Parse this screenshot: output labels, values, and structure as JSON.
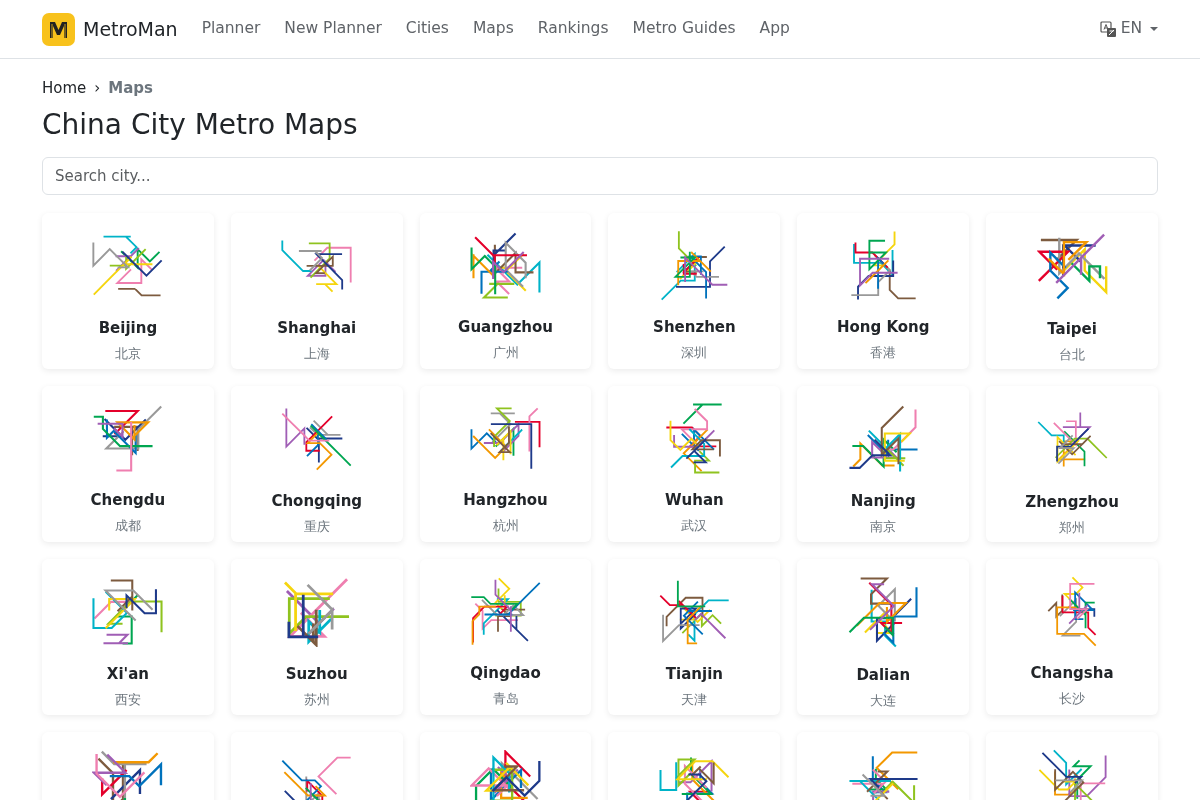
{
  "brand": "MetroMan",
  "nav": [
    {
      "label": "Planner"
    },
    {
      "label": "New Planner"
    },
    {
      "label": "Cities"
    },
    {
      "label": "Maps"
    },
    {
      "label": "Rankings"
    },
    {
      "label": "Metro Guides"
    },
    {
      "label": "App"
    }
  ],
  "language": "EN",
  "breadcrumb": [
    {
      "label": "Home",
      "current": false
    },
    {
      "label": "Maps",
      "current": true
    }
  ],
  "breadcrumb_separator": "›",
  "title": "China City Metro Maps",
  "search": {
    "placeholder": "Search city..."
  },
  "cities": [
    {
      "kind": "city",
      "name": "Beijing",
      "name_zh": "北京"
    },
    {
      "kind": "city",
      "name": "Shanghai",
      "name_zh": "上海"
    },
    {
      "kind": "city",
      "name": "Guangzhou",
      "name_zh": "广州"
    },
    {
      "kind": "city",
      "name": "Shenzhen",
      "name_zh": "深圳"
    },
    {
      "kind": "city",
      "name": "Hong Kong",
      "name_zh": "香港"
    },
    {
      "kind": "city",
      "name": "Taipei",
      "name_zh": "台北"
    },
    {
      "kind": "city",
      "name": "Chengdu",
      "name_zh": "成都"
    },
    {
      "kind": "city",
      "name": "Chongqing",
      "name_zh": "重庆"
    },
    {
      "kind": "city",
      "name": "Hangzhou",
      "name_zh": "杭州"
    },
    {
      "kind": "city",
      "name": "Wuhan",
      "name_zh": "武汉"
    },
    {
      "kind": "city",
      "name": "Nanjing",
      "name_zh": "南京"
    },
    {
      "kind": "city",
      "name": "Zhengzhou",
      "name_zh": "郑州"
    },
    {
      "kind": "city",
      "name": "Xi'an",
      "name_zh": "西安"
    },
    {
      "kind": "city",
      "name": "Suzhou",
      "name_zh": "苏州"
    },
    {
      "kind": "city",
      "name": "Qingdao",
      "name_zh": "青岛"
    },
    {
      "kind": "city",
      "name": "Tianjin",
      "name_zh": "天津"
    },
    {
      "kind": "city",
      "name": "Dalian",
      "name_zh": "大连"
    },
    {
      "kind": "city",
      "name": "Changsha",
      "name_zh": "长沙"
    },
    {
      "kind": "map"
    },
    {
      "kind": "map"
    },
    {
      "kind": "map"
    },
    {
      "kind": "map"
    },
    {
      "kind": "map"
    },
    {
      "kind": "map"
    }
  ]
}
